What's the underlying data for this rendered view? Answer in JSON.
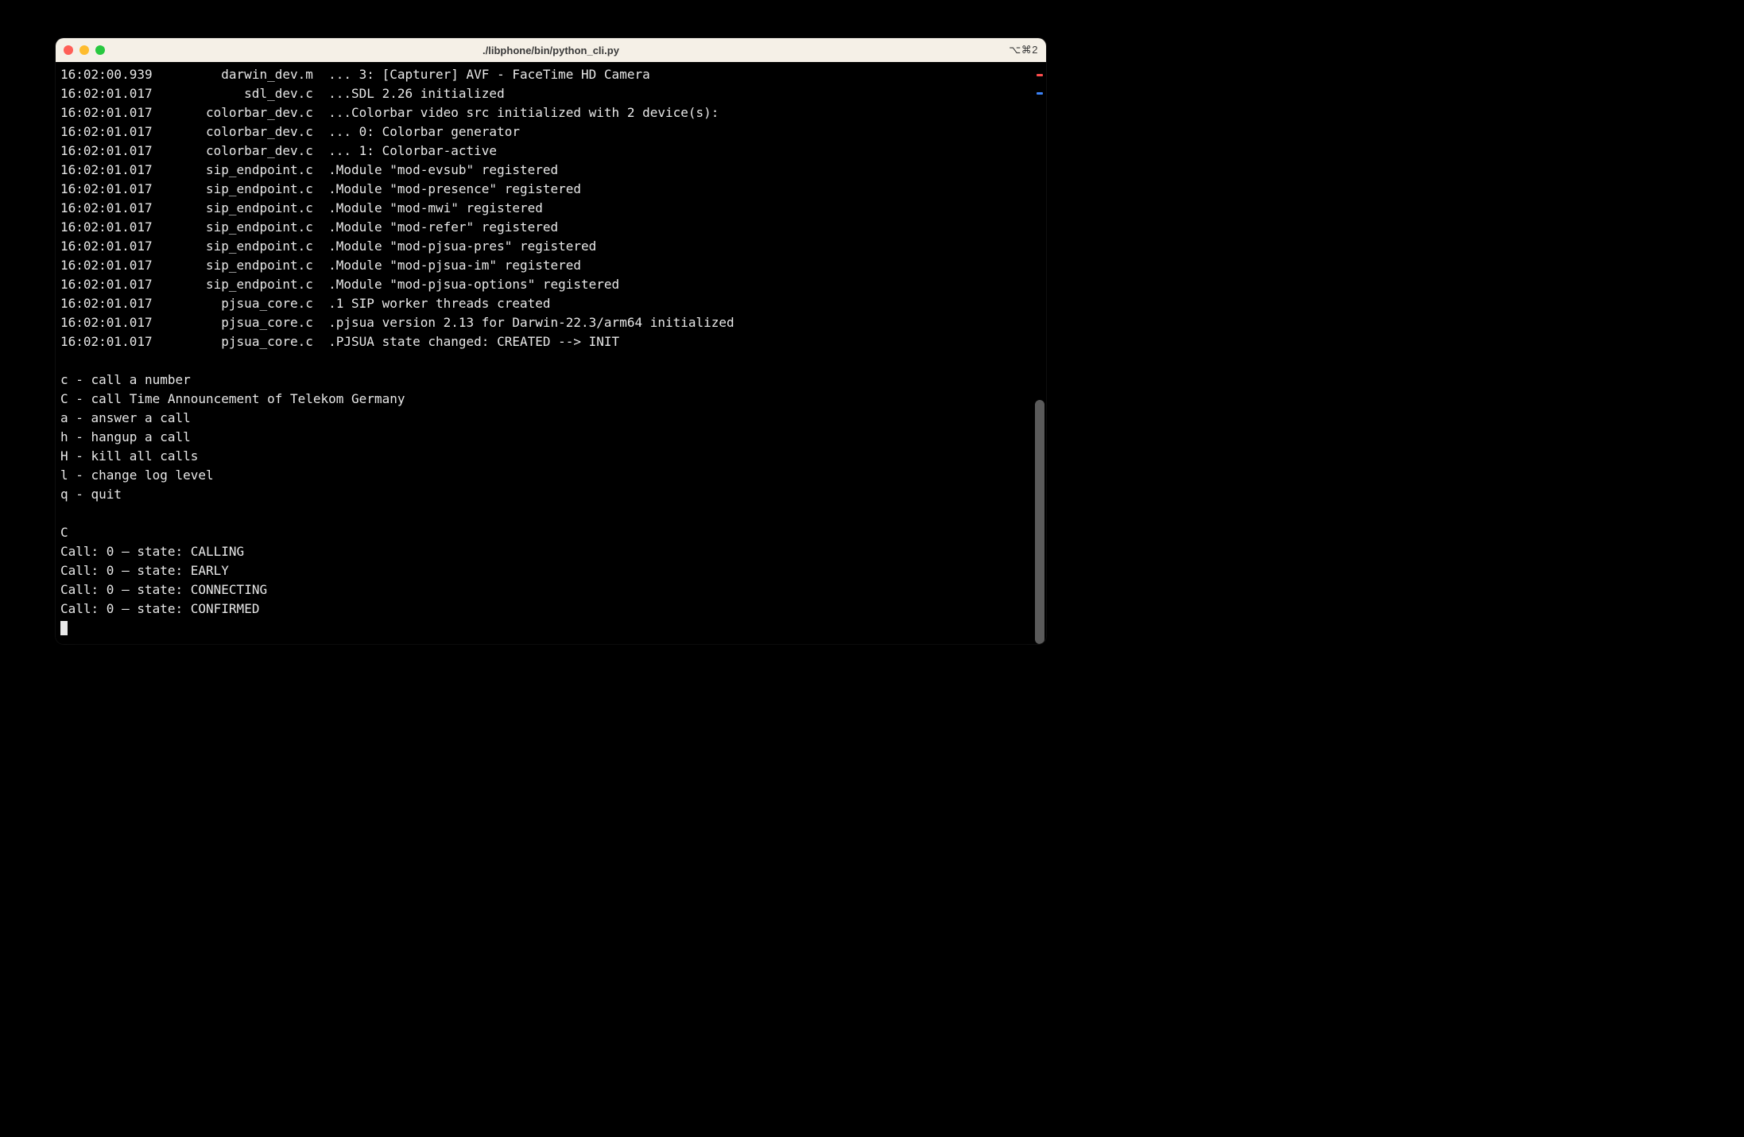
{
  "window": {
    "title": "./libphone/bin/python_cli.py",
    "shortcut": "⌥⌘2"
  },
  "log": [
    {
      "ts": "16:02:00.939",
      "src": "darwin_dev.m",
      "msg": "... 3: [Capturer] AVF - FaceTime HD Camera"
    },
    {
      "ts": "16:02:01.017",
      "src": "sdl_dev.c",
      "msg": "...SDL 2.26 initialized"
    },
    {
      "ts": "16:02:01.017",
      "src": "colorbar_dev.c",
      "msg": "...Colorbar video src initialized with 2 device(s):"
    },
    {
      "ts": "16:02:01.017",
      "src": "colorbar_dev.c",
      "msg": "... 0: Colorbar generator"
    },
    {
      "ts": "16:02:01.017",
      "src": "colorbar_dev.c",
      "msg": "... 1: Colorbar-active"
    },
    {
      "ts": "16:02:01.017",
      "src": "sip_endpoint.c",
      "msg": ".Module \"mod-evsub\" registered"
    },
    {
      "ts": "16:02:01.017",
      "src": "sip_endpoint.c",
      "msg": ".Module \"mod-presence\" registered"
    },
    {
      "ts": "16:02:01.017",
      "src": "sip_endpoint.c",
      "msg": ".Module \"mod-mwi\" registered"
    },
    {
      "ts": "16:02:01.017",
      "src": "sip_endpoint.c",
      "msg": ".Module \"mod-refer\" registered"
    },
    {
      "ts": "16:02:01.017",
      "src": "sip_endpoint.c",
      "msg": ".Module \"mod-pjsua-pres\" registered"
    },
    {
      "ts": "16:02:01.017",
      "src": "sip_endpoint.c",
      "msg": ".Module \"mod-pjsua-im\" registered"
    },
    {
      "ts": "16:02:01.017",
      "src": "sip_endpoint.c",
      "msg": ".Module \"mod-pjsua-options\" registered"
    },
    {
      "ts": "16:02:01.017",
      "src": "pjsua_core.c",
      "msg": ".1 SIP worker threads created"
    },
    {
      "ts": "16:02:01.017",
      "src": "pjsua_core.c",
      "msg": ".pjsua version 2.13 for Darwin-22.3/arm64 initialized"
    },
    {
      "ts": "16:02:01.017",
      "src": "pjsua_core.c",
      "msg": ".PJSUA state changed: CREATED --> INIT"
    }
  ],
  "menu": [
    "c - call a number",
    "C - call Time Announcement of Telekom Germany",
    "a - answer a call",
    "h - hangup a call",
    "H - kill all calls",
    "l - change log level",
    "q - quit"
  ],
  "input": "C",
  "call_states": [
    "Call: 0 – state: CALLING",
    "Call: 0 – state: EARLY",
    "Call: 0 – state: CONNECTING",
    "Call: 0 – state: CONFIRMED"
  ],
  "scrollbar": {
    "marks": [
      {
        "pos": 2.0,
        "cls": "r"
      },
      {
        "pos": 5.2,
        "cls": "b"
      }
    ],
    "thumb_start": 58,
    "thumb_end": 100
  }
}
